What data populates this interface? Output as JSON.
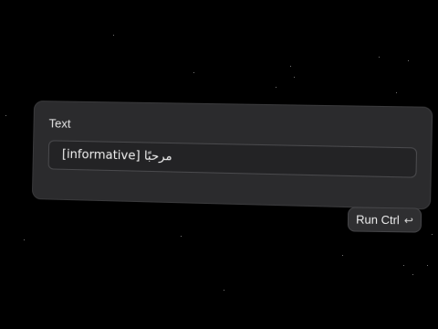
{
  "panel": {
    "label": "Text",
    "input": {
      "value": "[informative] مرحبًا",
      "placeholder": ""
    }
  },
  "run_button": {
    "label": "Run Ctrl",
    "icon": "enter-icon",
    "icon_glyph": "↩"
  },
  "colors": {
    "background": "#000000",
    "panel": "#2b2b2d",
    "field": "#232325",
    "text": "#e6e6e6"
  }
}
